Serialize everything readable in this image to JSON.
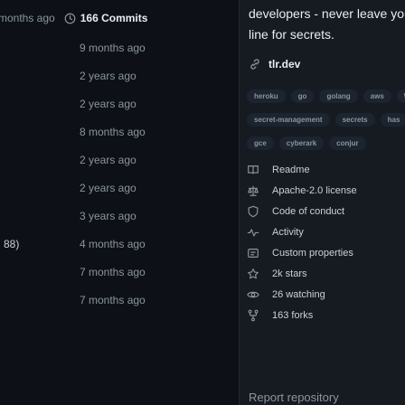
{
  "commits": {
    "ago": "months ago",
    "count_label": "166 Commits",
    "rows": [
      {
        "time": "9 months ago",
        "left": ""
      },
      {
        "time": "2 years ago",
        "left": ""
      },
      {
        "time": "2 years ago",
        "left": ""
      },
      {
        "time": "8 months ago",
        "left": ""
      },
      {
        "time": "2 years ago",
        "left": ""
      },
      {
        "time": "2 years ago",
        "left": ""
      },
      {
        "time": "3 years ago",
        "left": ""
      },
      {
        "time": "4 months ago",
        "left": "88)"
      },
      {
        "time": "7 months ago",
        "left": ""
      },
      {
        "time": "7 months ago",
        "left": ""
      }
    ]
  },
  "about": {
    "description_line1": "developers - never leave your c",
    "description_line2": "line for secrets.",
    "homepage": "tlr.dev",
    "topics_row1": [
      "heroku",
      "go",
      "golang",
      "aws",
      "\\"
    ],
    "topics_row2": [
      "secret-management",
      "secrets",
      "has"
    ],
    "topics_row3": [
      "gce",
      "cyberark",
      "conjur"
    ],
    "meta": [
      {
        "icon": "book-icon",
        "label": "Readme"
      },
      {
        "icon": "scale-icon",
        "label": "Apache-2.0 license"
      },
      {
        "icon": "shield-icon",
        "label": "Code of conduct"
      },
      {
        "icon": "pulse-icon",
        "label": "Activity"
      },
      {
        "icon": "properties-icon",
        "label": "Custom properties"
      },
      {
        "icon": "star-icon",
        "label": "2k stars"
      },
      {
        "icon": "eye-icon",
        "label": "26 watching"
      },
      {
        "icon": "fork-icon",
        "label": "163 forks"
      }
    ],
    "more_heading": "Report repository"
  }
}
